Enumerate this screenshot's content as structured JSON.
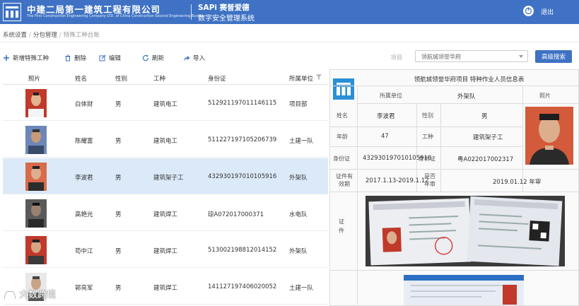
{
  "header": {
    "company_cn": "中建二局第一建筑工程有限公司",
    "company_en": "The First Construction Engineering Company LTD. of China Construction Second Engineering Bureau",
    "sys_en": "SAPi 赛普爱德",
    "sys_cn": "数字安全管理系统",
    "logout": "退出"
  },
  "breadcrumb": [
    "系统设置",
    "分包管理",
    "特殊工种台账"
  ],
  "toolbar": {
    "add": "新增特殊工种",
    "delete": "删除",
    "edit": "编辑",
    "refresh": "刷新",
    "import": "导入",
    "project_label": "项目",
    "project_value": "领航城领誉华府",
    "search": "高级搜索"
  },
  "table": {
    "headers": [
      "照片",
      "姓名",
      "性别",
      "工种",
      "身份证",
      "所属单位"
    ],
    "rows": [
      {
        "name": "白体财",
        "gender": "男",
        "type": "建筑电工",
        "id": "512921197011146115",
        "unit": "项目部"
      },
      {
        "name": "陈耀富",
        "gender": "男",
        "type": "建筑电工",
        "id": "511227197105206739",
        "unit": "土建一队"
      },
      {
        "name": "李波君",
        "gender": "男",
        "type": "建筑架子工",
        "id": "432930197010105916",
        "unit": "外架队"
      },
      {
        "name": "高艳光",
        "gender": "男",
        "type": "建筑焊工",
        "id": "琼A072017000371",
        "unit": "水电队"
      },
      {
        "name": "苟中江",
        "gender": "男",
        "type": "建筑焊工",
        "id": "513002198812014152",
        "unit": "外架队"
      },
      {
        "name": "郭亮军",
        "gender": "男",
        "type": "建筑焊工",
        "id": "141127197406020052",
        "unit": "土建一队"
      }
    ]
  },
  "panel": {
    "title": "领航城领誉华府项目 特种作业人员信息表",
    "unit_label": "所属单位",
    "unit_value": "外架队",
    "photo_label": "照片",
    "name_label": "姓名",
    "name_value": "李波君",
    "gender_label": "性别",
    "gender_value": "男",
    "age_label": "年龄",
    "age_value": "47",
    "type_label": "工种",
    "type_value": "建筑架子工",
    "id_label": "身份证",
    "id_value": "432930197010105916",
    "cert_label": "身份证",
    "cert_value": "粤A022017002317",
    "valid_label": "证件有效期",
    "valid_value": "2017.1.13-2019.1.12",
    "review_label": "是否年审",
    "review_value": "2019.01.12 年审",
    "certificate_label": "证件"
  },
  "watermark": "大数跨境",
  "colors": {
    "brand": "#3f72c4",
    "selected_row": "#dbe9f8"
  }
}
